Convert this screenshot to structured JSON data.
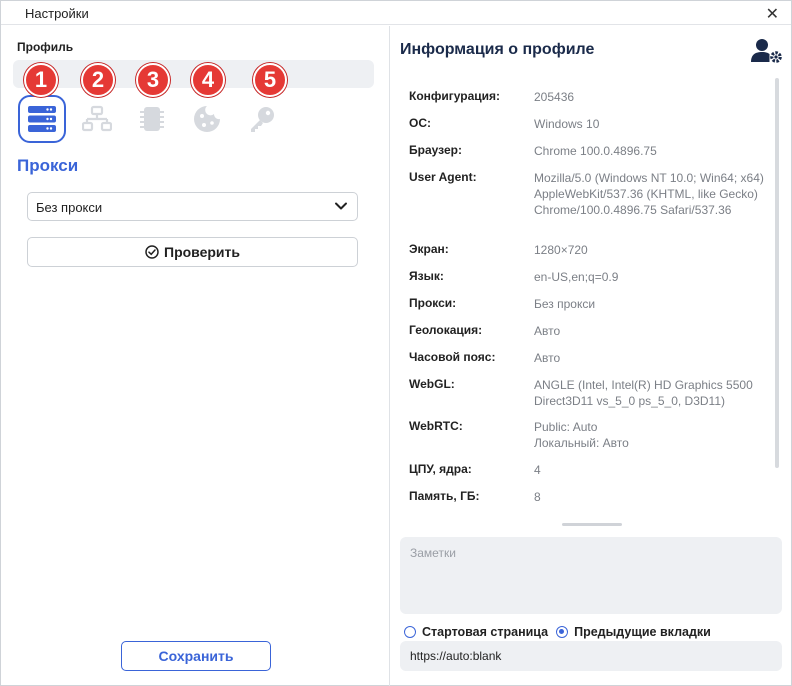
{
  "window": {
    "title": "Настройки",
    "close_glyph": "✕"
  },
  "left": {
    "profile_label": "Профиль",
    "tabs": [
      {
        "badge": "1",
        "icon": "server-icon",
        "active": true
      },
      {
        "badge": "2",
        "icon": "network-icon",
        "active": false
      },
      {
        "badge": "3",
        "icon": "chip-icon",
        "active": false
      },
      {
        "badge": "4",
        "icon": "cookie-icon",
        "active": false
      },
      {
        "badge": "5",
        "icon": "key-icon",
        "active": false
      }
    ],
    "proxy_heading": "Прокси",
    "proxy_select_value": "Без прокси",
    "check_button": "Проверить",
    "save_button": "Сохранить"
  },
  "right": {
    "title": "Информация о профиле",
    "rows": [
      {
        "key": "Конфигурация:",
        "value": "205436"
      },
      {
        "key": "ОС:",
        "value": "Windows 10"
      },
      {
        "key": "Браузер:",
        "value": "Chrome 100.0.4896.75"
      },
      {
        "key": "User Agent:",
        "value": "Mozilla/5.0 (Windows NT 10.0; Win64; x64) AppleWebKit/537.36 (KHTML, like Gecko) Chrome/100.0.4896.75 Safari/537.36"
      },
      {
        "key": "Экран:",
        "value": "1280×720"
      },
      {
        "key": "Язык:",
        "value": "en-US,en;q=0.9"
      },
      {
        "key": "Прокси:",
        "value": "Без прокси"
      },
      {
        "key": "Геолокация:",
        "value": "Авто"
      },
      {
        "key": "Часовой пояс:",
        "value": "Авто"
      },
      {
        "key": "WebGL:",
        "value": "ANGLE (Intel, Intel(R) HD Graphics 5500 Direct3D11 vs_5_0 ps_5_0, D3D11)"
      },
      {
        "key": "WebRTC:",
        "value": "Public: Auto",
        "value2": "Локальный: Авто"
      },
      {
        "key": "ЦПУ, ядра:",
        "value": "4"
      },
      {
        "key": "Память, ГБ:",
        "value": "8"
      }
    ],
    "notes_placeholder": "Заметки",
    "radio_start": "Стартовая страница",
    "radio_prev": "Предыдущие вкладки",
    "radio_selected": "prev",
    "url_value": "https://auto:blank"
  },
  "colors": {
    "accent": "#3a64d8",
    "badge": "#e53935",
    "navy": "#1a2a4a"
  }
}
